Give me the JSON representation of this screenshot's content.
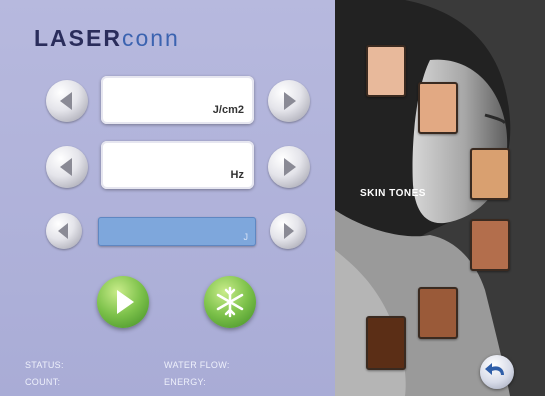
{
  "brand": {
    "part1": "LASER",
    "part2": "conn"
  },
  "controls": {
    "row1": {
      "value": "",
      "unit": "J/cm2"
    },
    "row2": {
      "value": "",
      "unit": "Hz"
    },
    "row3": {
      "value": "",
      "unit": "J"
    }
  },
  "buttons": {
    "start_icon": "play-icon",
    "cooling_icon": "snowflake-icon",
    "back_icon": "back-arrow-icon"
  },
  "status": {
    "status_label": "STATUS:",
    "count_label": "COUNT:",
    "water_flow_label": "WATER FLOW:",
    "energy_label": "ENERGY:"
  },
  "skin": {
    "label": "SKIN TONES",
    "swatches": [
      {
        "color": "#e8b99b"
      },
      {
        "color": "#e2a983"
      },
      {
        "color": "#d9a070"
      },
      {
        "color": "#b36e4c"
      },
      {
        "color": "#9a5a39"
      },
      {
        "color": "#5b2e16"
      }
    ]
  }
}
